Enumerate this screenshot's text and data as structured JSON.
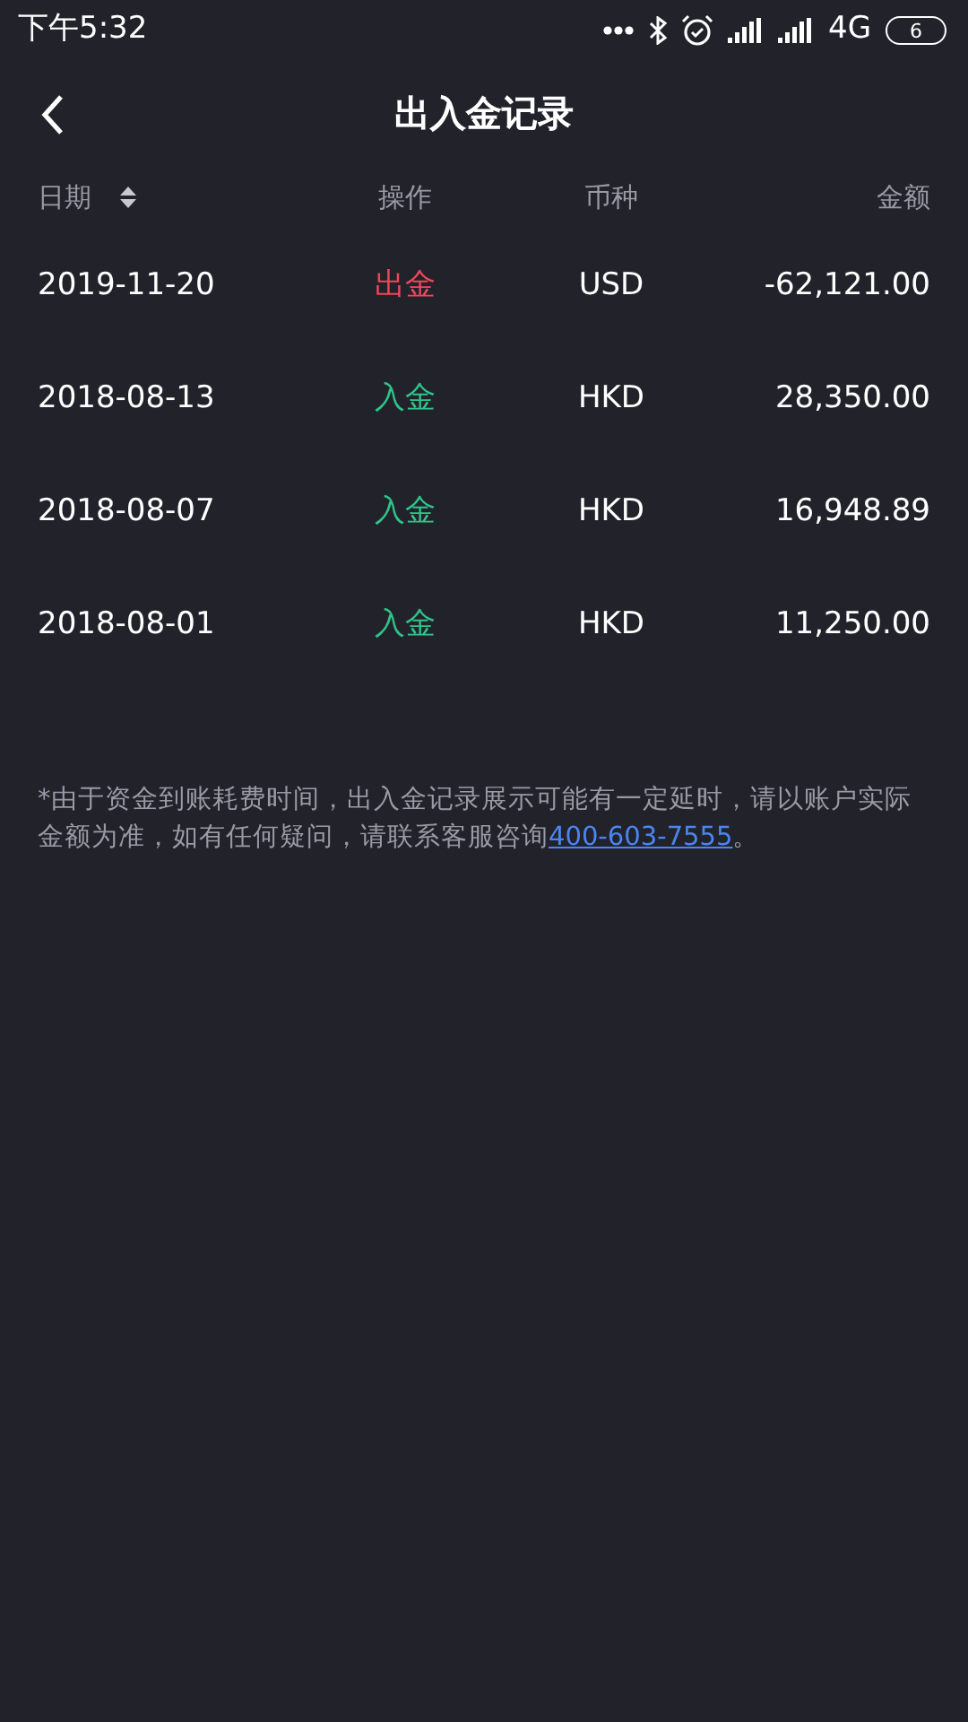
{
  "status_bar": {
    "time": "下午5:32",
    "network": "4G",
    "battery": "6"
  },
  "header": {
    "title": "出入金记录"
  },
  "table": {
    "columns": [
      {
        "label": "日期",
        "sortable": true
      },
      {
        "label": "操作"
      },
      {
        "label": "币种"
      },
      {
        "label": "金额"
      }
    ],
    "rows": [
      {
        "date": "2019-11-20",
        "operation": "出金",
        "kind": "withdrawal",
        "currency": "USD",
        "amount": "-62,121.00"
      },
      {
        "date": "2018-08-13",
        "operation": "入金",
        "kind": "deposit",
        "currency": "HKD",
        "amount": "28,350.00"
      },
      {
        "date": "2018-08-07",
        "operation": "入金",
        "kind": "deposit",
        "currency": "HKD",
        "amount": "16,948.89"
      },
      {
        "date": "2018-08-01",
        "operation": "入金",
        "kind": "deposit",
        "currency": "HKD",
        "amount": "11,250.00"
      }
    ]
  },
  "note": {
    "text": "*由于资金到账耗费时间，出入金记录展示可能有一定延时，请以账户实际金额为准，如有任何疑问，请联系客服咨询",
    "link": "400-603-7555",
    "end": "。"
  }
}
